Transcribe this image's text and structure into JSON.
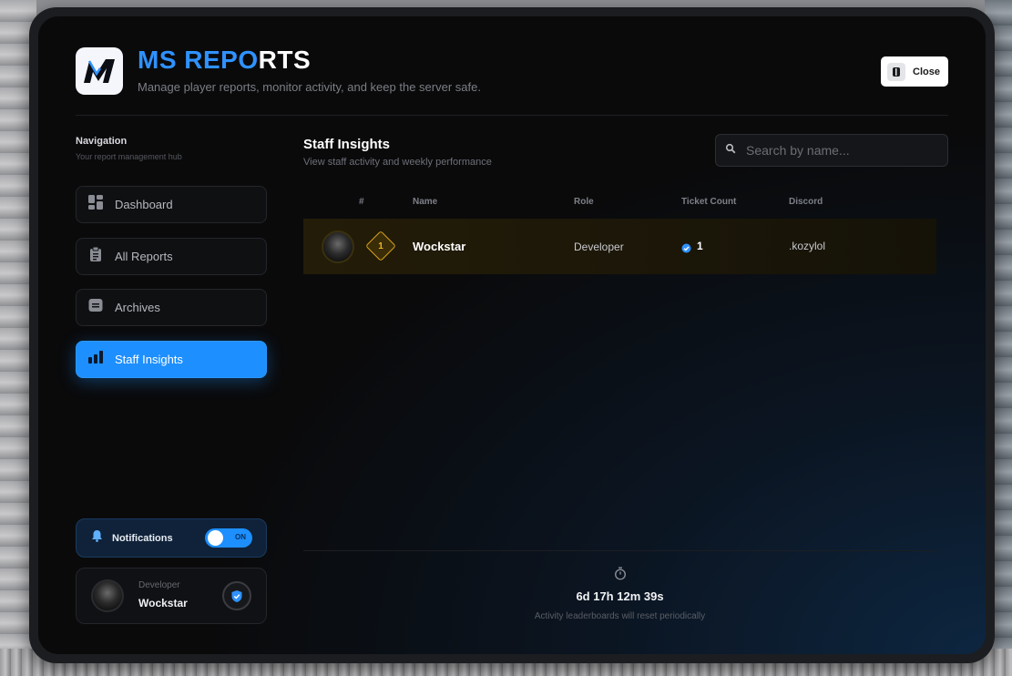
{
  "header": {
    "title_part1": "MS REPO",
    "title_part2": "RTS",
    "subtitle": "Manage player reports, monitor activity, and keep the server safe.",
    "close_label": "Close"
  },
  "sidebar": {
    "title": "Navigation",
    "subtitle": "Your report management hub",
    "items": [
      {
        "label": "Dashboard",
        "icon": "dashboard-icon"
      },
      {
        "label": "All Reports",
        "icon": "clipboard-icon"
      },
      {
        "label": "Archives",
        "icon": "archive-icon"
      },
      {
        "label": "Staff Insights",
        "icon": "bar-chart-icon",
        "active": true
      }
    ],
    "notifications": {
      "label": "Notifications",
      "toggle_text": "ON",
      "enabled": true
    },
    "profile": {
      "role": "Developer",
      "name": "Wockstar"
    }
  },
  "main": {
    "title": "Staff Insights",
    "subtitle": "View staff activity and weekly performance",
    "search_placeholder": "Search by name...",
    "columns": [
      "#",
      "Name",
      "Role",
      "Ticket Count",
      "Discord"
    ],
    "rows": [
      {
        "rank": "1",
        "name": "Wockstar",
        "role": "Developer",
        "ticket_count": "1",
        "discord": ".kozylol"
      }
    ],
    "timer": "6d 17h 12m 39s",
    "reset_note": "Activity leaderboards will reset periodically"
  },
  "colors": {
    "accent": "#1d8fff",
    "gold": "#d6a21d",
    "background": "#0a0a0b"
  }
}
